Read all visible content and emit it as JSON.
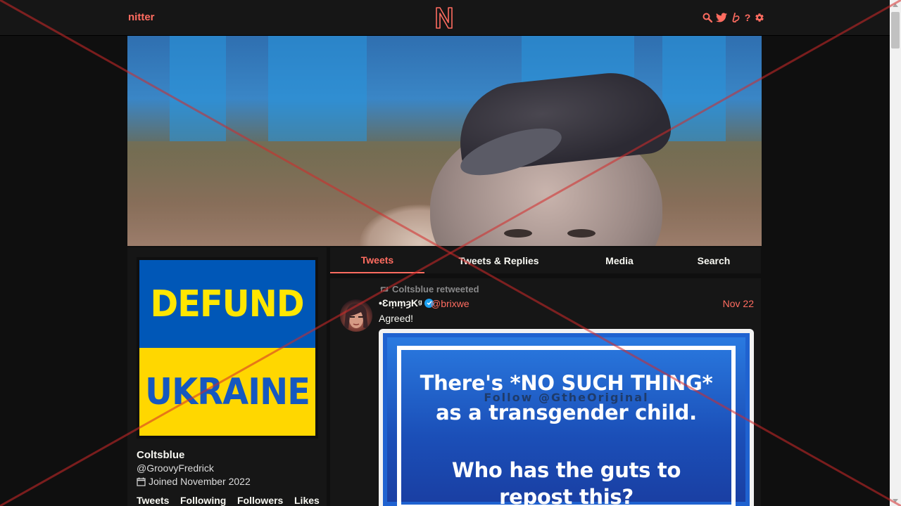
{
  "nav": {
    "brand": "nitter",
    "logo_letter": "N",
    "icons": [
      "search-icon",
      "twitter-bird-icon",
      "liberapay-icon",
      "help-icon",
      "gear-icon"
    ],
    "help_glyph": "?"
  },
  "banner": {
    "alt": "profile banner photo"
  },
  "profile": {
    "avatar_top_text": "DEFUND",
    "avatar_bottom_text": "UKRAINE",
    "fullname": "Coltsblue",
    "username": "@GroovyFredrick",
    "joined": "Joined November 2022",
    "stats": [
      "Tweets",
      "Following",
      "Followers",
      "Likes"
    ]
  },
  "tabs": [
    {
      "label": "Tweets",
      "active": true
    },
    {
      "label": "Tweets & Replies",
      "active": false
    },
    {
      "label": "Media",
      "active": false
    },
    {
      "label": "Search",
      "active": false
    }
  ],
  "tweet": {
    "retweet_header": "Coltsblue retweeted",
    "fullname": "•ƐṃṃȝKᵍ",
    "username": "@brixwe",
    "date": "Nov 22",
    "text": "Agreed!",
    "image_lines": {
      "line1": "There's *NO SUCH THING*",
      "follow": "Follow @GtheOriginal",
      "line2": "as a transgender child.",
      "line3": "Who has the guts to",
      "line4": "repost this?"
    }
  },
  "colors": {
    "accent": "#ff6c60",
    "background": "#0f0f0f",
    "panel": "#161616",
    "text": "#f8f8f2",
    "flag_blue": "#0057b7",
    "flag_yellow": "#ffd700",
    "overlay_x": "#d42a2a"
  }
}
